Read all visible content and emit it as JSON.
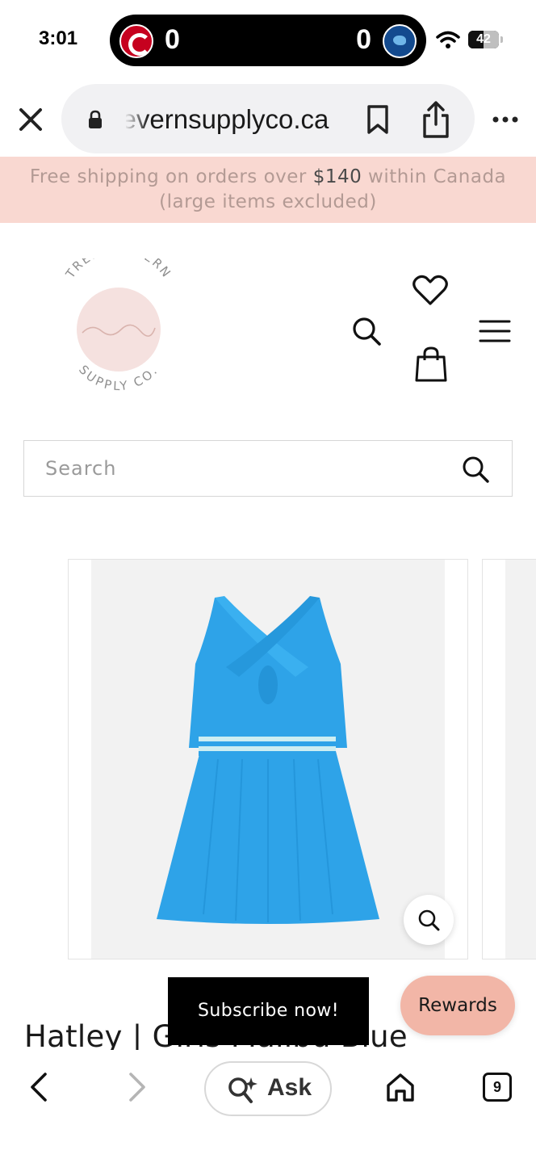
{
  "status_bar": {
    "time": "3:01",
    "live_activity": {
      "home_score": "0",
      "away_score": "0"
    },
    "battery": "42"
  },
  "browser": {
    "url": "trentsevernsupplyco.ca",
    "icons": [
      "close-icon",
      "lock-icon",
      "bookmark-icon",
      "share-icon",
      "more-icon"
    ]
  },
  "announcement": {
    "text_before": "Free shipping on orders over ",
    "amount": "$140",
    "text_after": " within Canada (large items excluded)"
  },
  "header": {
    "logo": {
      "top_text": "TRENT-SEVERN",
      "bottom_text": "SUPPLY CO."
    },
    "icons": [
      "search-icon",
      "heart-icon",
      "bag-icon",
      "menu-icon"
    ]
  },
  "search": {
    "placeholder": "Search",
    "value": ""
  },
  "product": {
    "title": "Hatley | Girls Malibu Blue",
    "colors": {
      "dress": "#2ea3e8",
      "band": "#cdeef2"
    }
  },
  "overlays": {
    "subscribe_label": "Subscribe now!",
    "rewards_label": "Rewards"
  },
  "bottom_toolbar": {
    "ask_label": "Ask",
    "tab_count": "9"
  }
}
